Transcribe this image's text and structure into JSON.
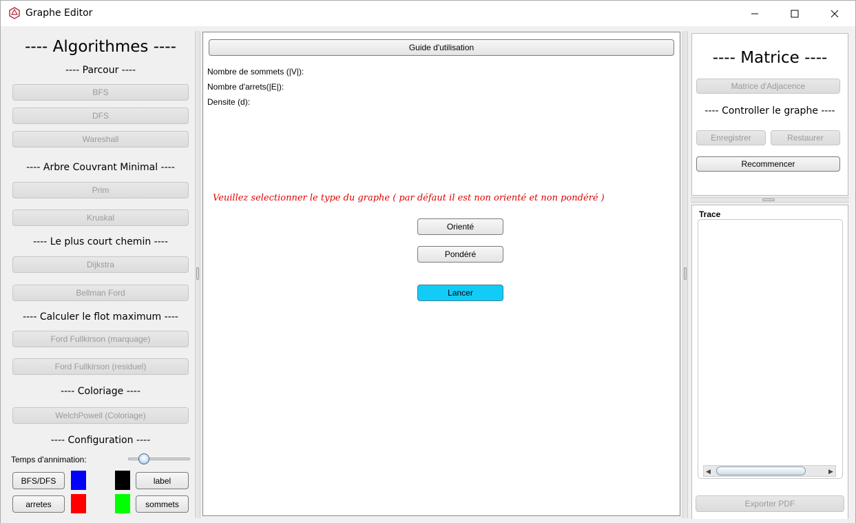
{
  "window": {
    "title": "Graphe Editor",
    "controls": [
      "minimize-icon",
      "maximize-icon",
      "close-icon"
    ]
  },
  "left": {
    "title": "---- Algorithmes ----",
    "sections": {
      "parcour": "---- Parcour ----",
      "arbre": "---- Arbre Couvrant Minimal  ----",
      "court": "---- Le plus court chemin  ----",
      "flot": "---- Calculer le flot maximum  ----",
      "coloriage": "---- Coloriage  ----",
      "configuration": "---- Configuration  ----"
    },
    "buttons": {
      "bfs": "BFS",
      "dfs": "DFS",
      "wareshall": "Wareshall",
      "prim": "Prim",
      "kruskal": "Kruskal",
      "dijkstra": "Dijkstra",
      "bellman": "Bellman Ford",
      "ford_marquage": "Ford Fullkirson (marquage)",
      "ford_residuel": "Ford Fullkirson (residuel)",
      "welch": "WelchPowell (Coloriage)"
    },
    "config": {
      "anim_label": "Temps d'annimation:",
      "anim_value": 0.25,
      "bfsdfs": "BFS/DFS",
      "label": "label",
      "arretes": "arretes",
      "sommets": "sommets",
      "colors": {
        "bfsdfs": "#0000ff",
        "label": "#000000",
        "arretes": "#ff0000",
        "sommets": "#00ff00"
      }
    }
  },
  "center": {
    "guide": "Guide d'utilisation",
    "stats": {
      "sommets": "Nombre de sommets (|V|):",
      "arrets": "Nombre d'arrets(|E|):",
      "densite": "Densite (d):"
    },
    "warning": "Veuillez selectionner le type du graphe ( par défaut il est non orienté et non pondéré )",
    "oriente": "Orienté",
    "pondere": "Pondéré",
    "lancer": "Lancer",
    "accent": "#12ccf7",
    "warning_color": "#e00000"
  },
  "right": {
    "title": "---- Matrice ----",
    "matrice": "Matrice d'Adjacence",
    "controller": "---- Controller le graphe ----",
    "enregistrer": "Enregistrer",
    "restaurer": "Restaurer",
    "recommencer": "Recommencer",
    "trace": "Trace",
    "exporter": "Exporter PDF"
  }
}
